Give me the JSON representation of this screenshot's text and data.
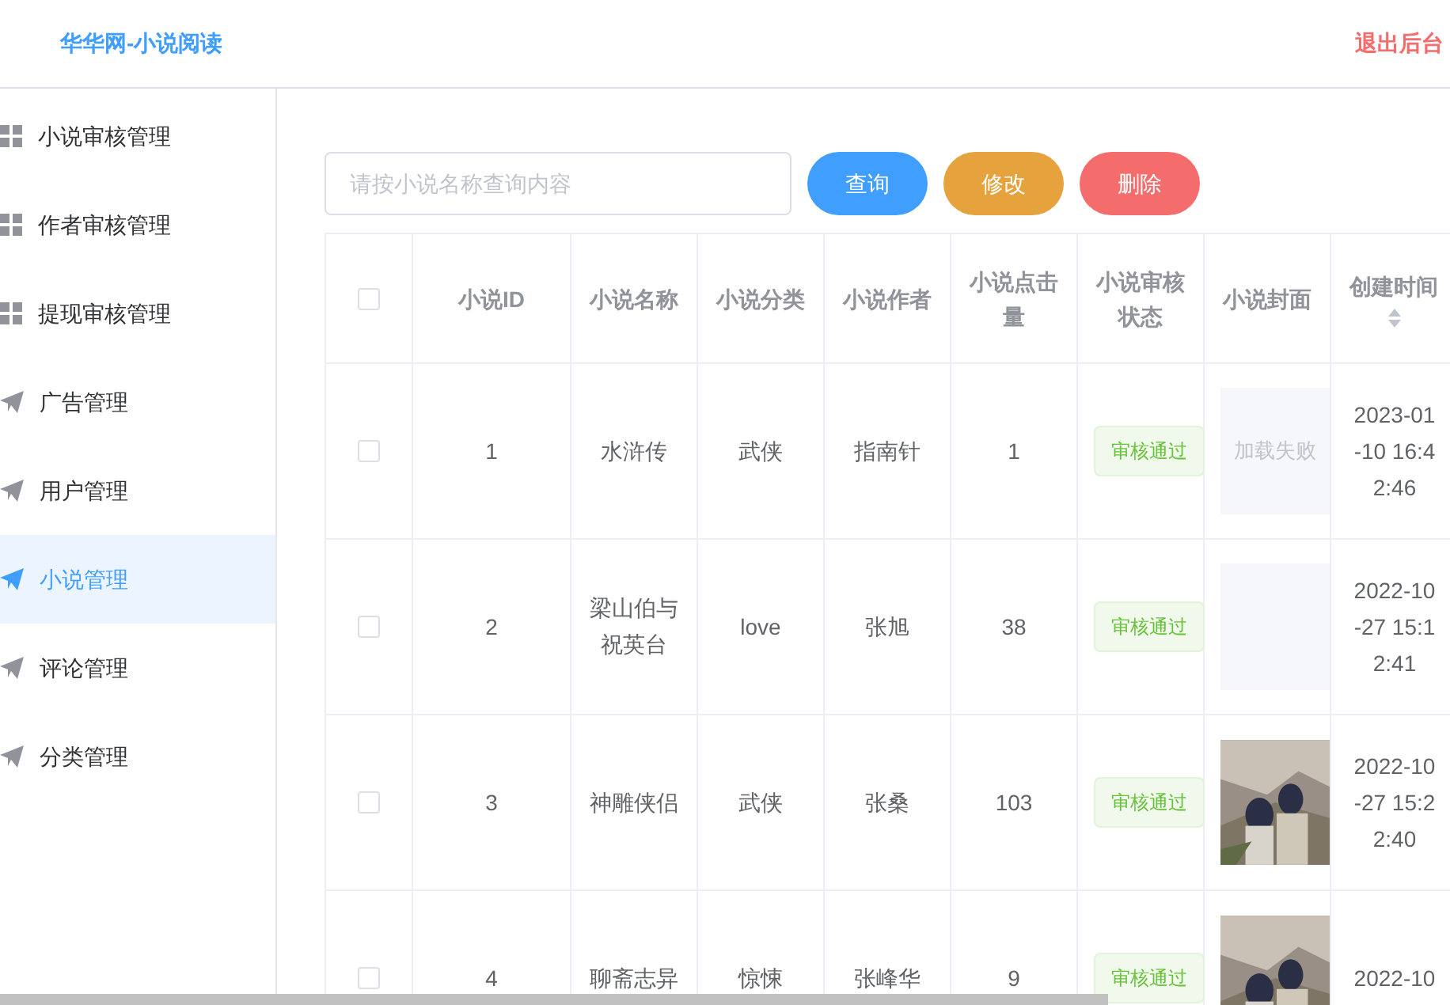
{
  "header": {
    "title": "华华网-小说阅读",
    "logout": "退出后台"
  },
  "sidebar": {
    "items": [
      {
        "label": "小说审核管理",
        "kind": "grid",
        "selected": false
      },
      {
        "label": "作者审核管理",
        "kind": "grid",
        "selected": false
      },
      {
        "label": "提现审核管理",
        "kind": "grid",
        "selected": false
      },
      {
        "label": "广告管理",
        "kind": "send",
        "selected": false
      },
      {
        "label": "用户管理",
        "kind": "send",
        "selected": false
      },
      {
        "label": "小说管理",
        "kind": "send",
        "selected": true
      },
      {
        "label": "评论管理",
        "kind": "send",
        "selected": false
      },
      {
        "label": "分类管理",
        "kind": "send",
        "selected": false
      }
    ]
  },
  "search": {
    "placeholder": "请按小说名称查询内容"
  },
  "buttons": [
    {
      "label": "查询",
      "kind": "primary"
    },
    {
      "label": "修改",
      "kind": "warning"
    },
    {
      "label": "删除",
      "kind": "danger"
    }
  ],
  "table": {
    "select_all": {
      "checked": false
    },
    "columns": [
      {
        "label": "小说ID"
      },
      {
        "label": "小说名称"
      },
      {
        "label": "小说分类"
      },
      {
        "label": "小说作者"
      },
      {
        "label": "小说点击量"
      },
      {
        "label": "小说审核状态"
      },
      {
        "label": "小说封面"
      },
      {
        "label": "创建时间",
        "sortable": true
      }
    ],
    "rows": [
      {
        "checked": false,
        "id": "1",
        "name": "水浒传",
        "category": "武侠",
        "author": "指南针",
        "clicks": "1",
        "status": "审核通过",
        "cover": {
          "kind": "failed",
          "text": "加载失败"
        },
        "created": "2023-01-10 16:42:46"
      },
      {
        "checked": false,
        "id": "2",
        "name": "梁山伯与祝英台",
        "category": "love",
        "author": "张旭",
        "clicks": "38",
        "status": "审核通过",
        "cover": {
          "kind": "blank"
        },
        "created": "2022-10-27 15:12:41"
      },
      {
        "checked": false,
        "id": "3",
        "name": "神雕侠侣",
        "category": "武侠",
        "author": "张桑",
        "clicks": "103",
        "status": "审核通过",
        "created": "2022-10-27 15:22:40"
      },
      {
        "checked": false,
        "id": "4",
        "name": "聊斋志异",
        "category": "惊悚",
        "author": "张峰华",
        "clicks": "9",
        "status": "审核通过",
        "created": "2022-10"
      }
    ]
  }
}
